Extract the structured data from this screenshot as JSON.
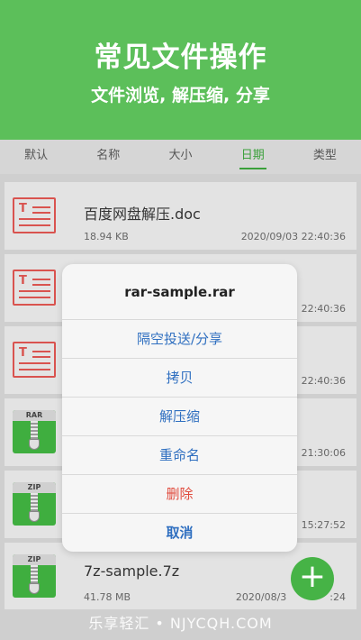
{
  "banner": {
    "title": "常见文件操作",
    "subtitle": "文件浏览, 解压缩, 分享"
  },
  "tabs": [
    {
      "label": "默认",
      "active": false
    },
    {
      "label": "名称",
      "active": false
    },
    {
      "label": "大小",
      "active": false
    },
    {
      "label": "日期",
      "active": true
    },
    {
      "label": "类型",
      "active": false
    }
  ],
  "files": [
    {
      "name": "百度网盘解压.doc",
      "size": "18.94 KB",
      "date": "2020/09/03 22:40:36",
      "icon": "doc-icon"
    },
    {
      "name": "",
      "size": "",
      "date": "22:40:36",
      "icon": "doc-icon"
    },
    {
      "name": "",
      "size": "",
      "date": "22:40:36",
      "icon": "doc-icon"
    },
    {
      "name": "",
      "size": "",
      "date": "21:30:06",
      "icon": "rar-icon",
      "badge": "RAR"
    },
    {
      "name": "",
      "size": "",
      "date": "15:27:52",
      "icon": "zip-icon",
      "badge": "ZIP"
    },
    {
      "name": "7z-sample.7z",
      "size": "41.78 MB",
      "date": "2020/08/3",
      "date_tail": ":24",
      "icon": "zip-icon",
      "badge": "ZIP"
    }
  ],
  "sheet": {
    "title": "rar-sample.rar",
    "options": [
      "隔空投送/分享",
      "拷贝",
      "解压缩",
      "重命名"
    ],
    "delete_label": "删除",
    "cancel_label": "取消"
  },
  "fab": {
    "label": "+"
  },
  "watermark": "乐享轻汇 • NJYCQH.COM",
  "colors": {
    "brand_green": "#5cbf5a",
    "link_blue": "#2f6fc0",
    "danger_red": "#e04a3c",
    "doc_red": "#d9534f"
  }
}
